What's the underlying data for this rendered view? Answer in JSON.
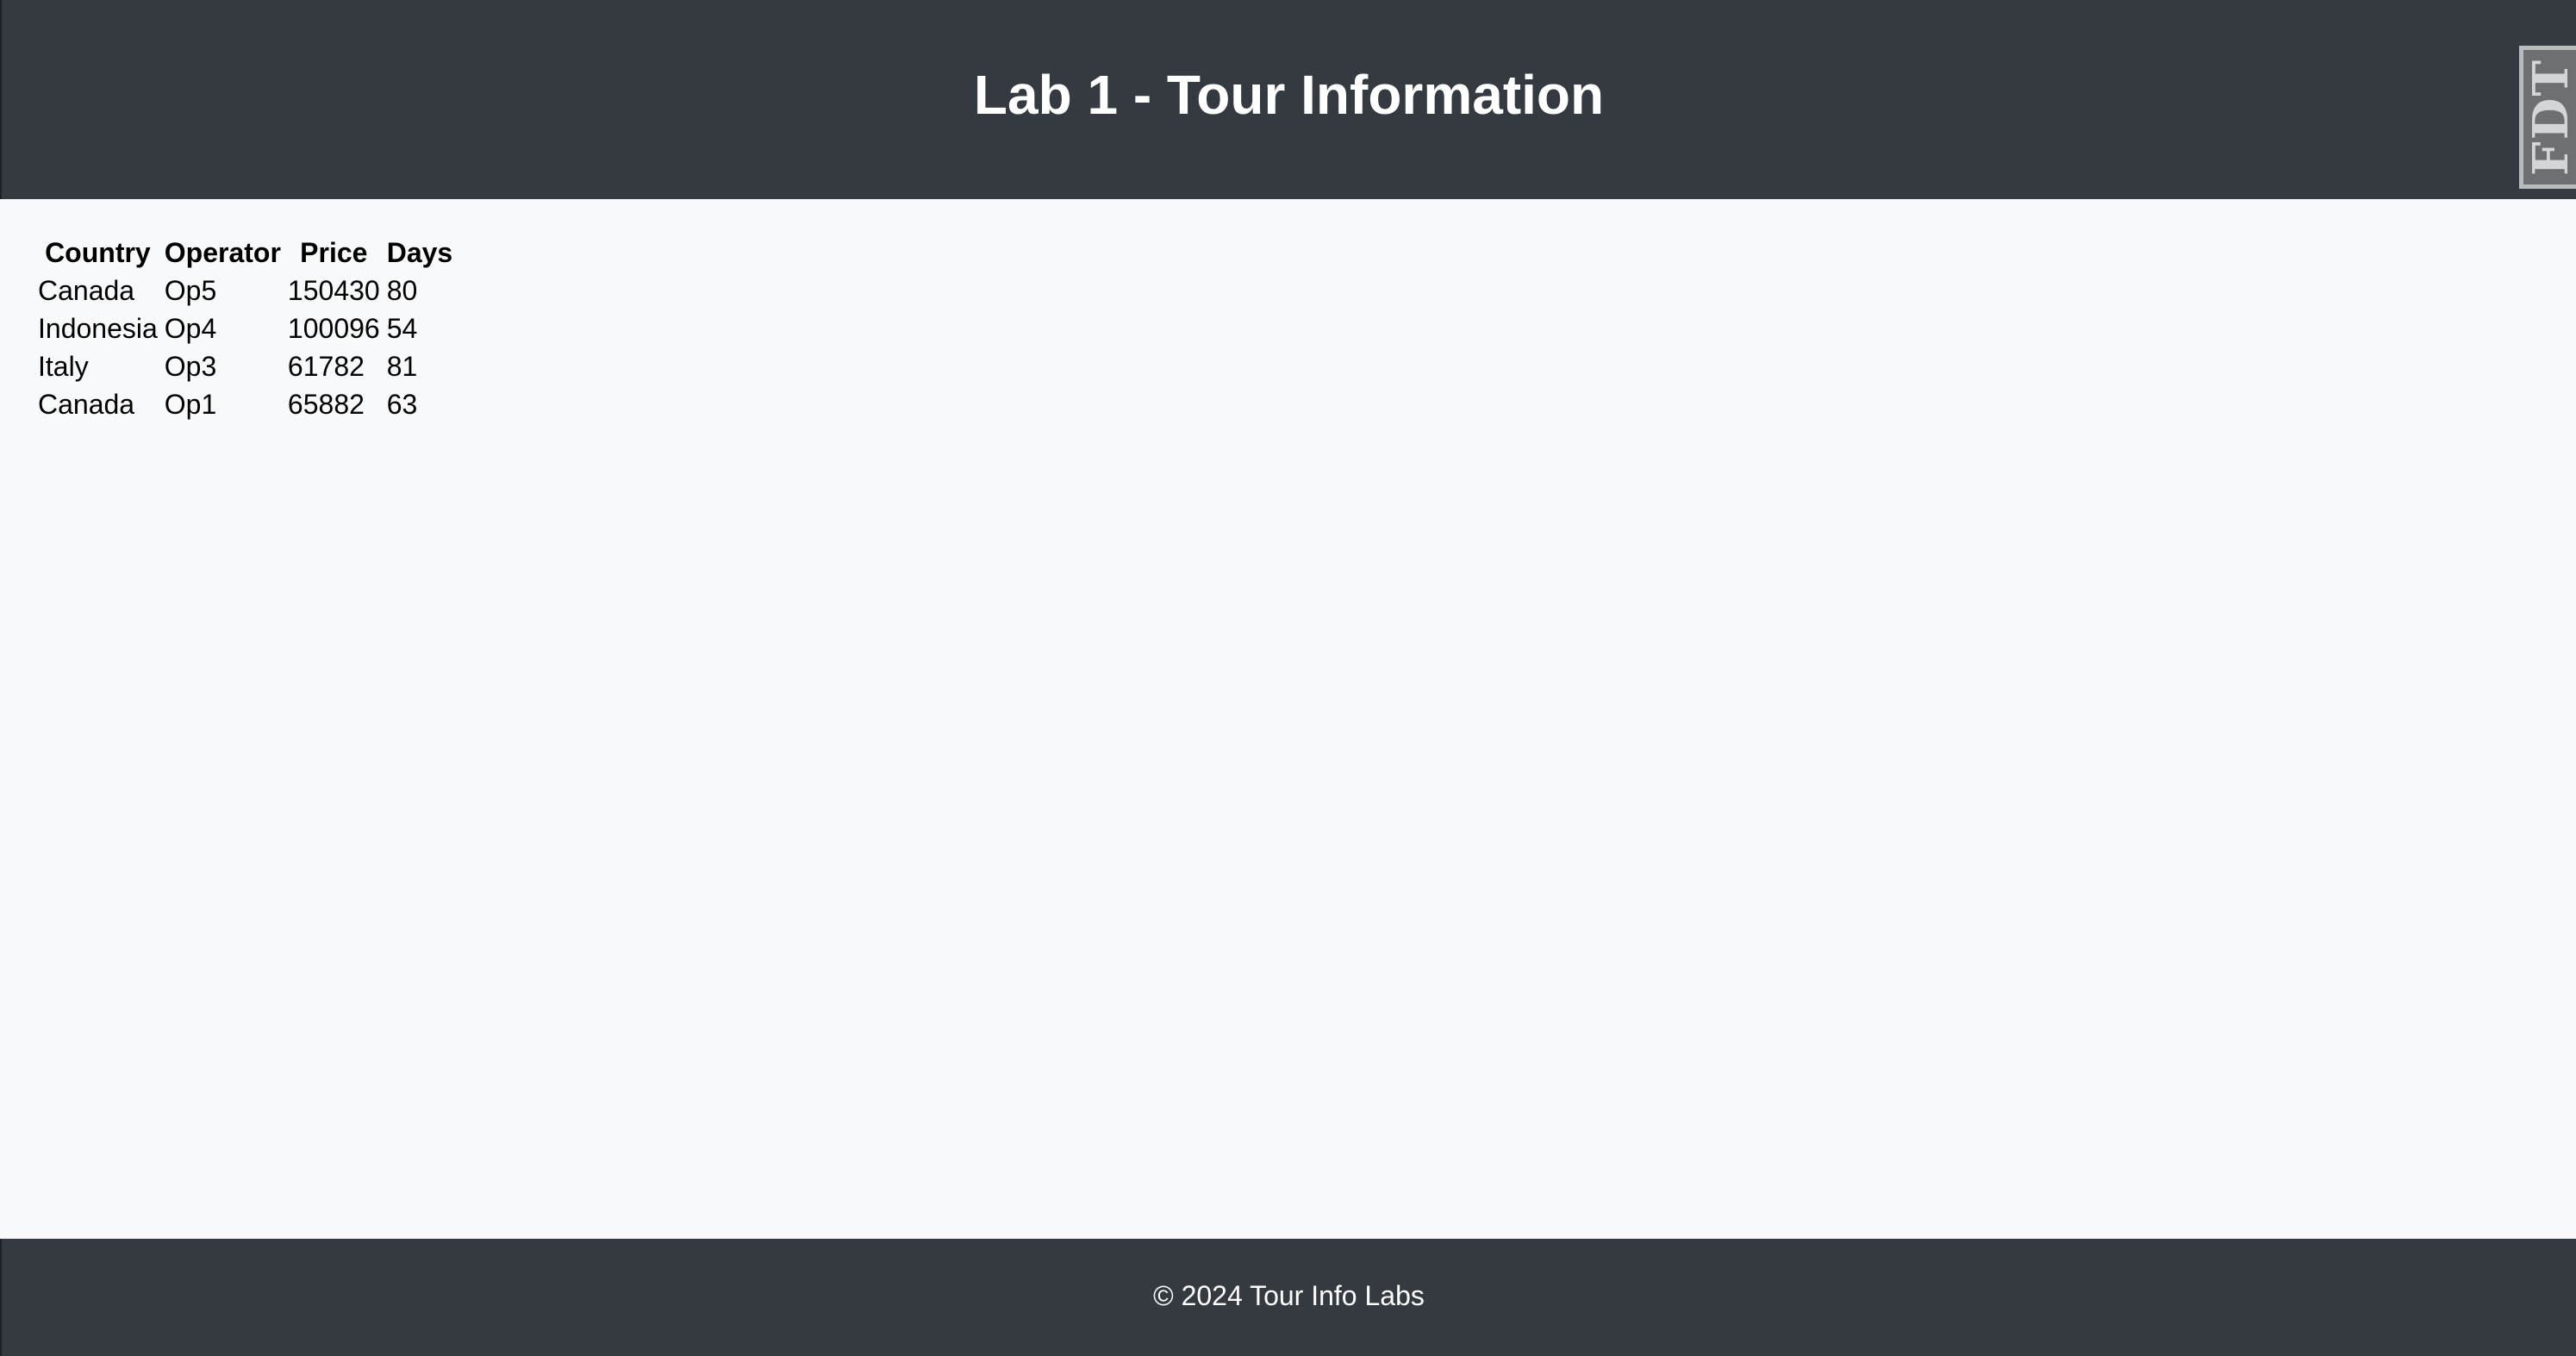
{
  "header": {
    "title": "Lab 1 - Tour Information",
    "badge_text": "FDT"
  },
  "table": {
    "columns": [
      "Country",
      "Operator",
      "Price",
      "Days"
    ],
    "rows": [
      [
        "Canada",
        "Op5",
        "150430",
        "80"
      ],
      [
        "Indonesia",
        "Op4",
        "100096",
        "54"
      ],
      [
        "Italy",
        "Op3",
        "61782",
        "81"
      ],
      [
        "Canada",
        "Op1",
        "65882",
        "63"
      ]
    ]
  },
  "footer": {
    "text": "© 2024 Tour Info Labs"
  },
  "colors": {
    "header_bg": "#343a40",
    "page_bg": "#f8f9fa",
    "badge_bg": "#6d6f72"
  }
}
